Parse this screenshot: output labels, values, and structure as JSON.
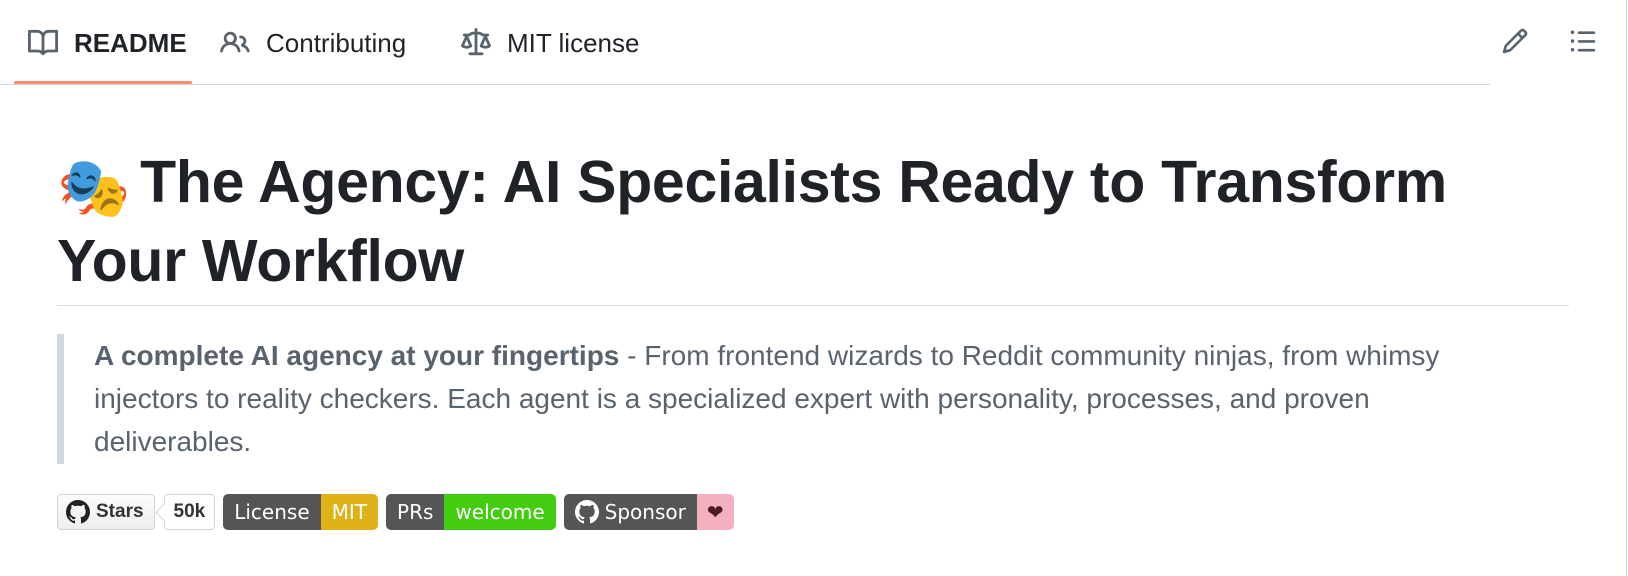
{
  "tabs": [
    {
      "label": "README",
      "icon": "book-icon",
      "active": true
    },
    {
      "label": "Contributing",
      "icon": "people-icon",
      "active": false
    },
    {
      "label": "MIT license",
      "icon": "law-scale-icon",
      "active": false
    }
  ],
  "toolbar": {
    "edit_icon": "pencil-icon",
    "toc_icon": "list-unordered-icon"
  },
  "readme": {
    "title_emoji": "🎭",
    "title": "The Agency: AI Specialists Ready to Transform Your Workflow",
    "quote_lead": "A complete AI agency at your fingertips",
    "quote_rest": " - From frontend wizards to Reddit community ninjas, from whimsy injectors to reality checkers. Each agent is a specialized expert with personality, processes, and proven deliverables."
  },
  "badges": {
    "stars": {
      "label": "Stars",
      "count": "50k"
    },
    "license": {
      "label": "License",
      "value": "MIT",
      "color": "#dfb317"
    },
    "prs": {
      "label": "PRs",
      "value": "welcome",
      "color": "#44cc11"
    },
    "sponsor": {
      "label": "Sponsor",
      "value": "❤",
      "color": "#f5b0c0"
    }
  },
  "colors": {
    "active_tab_underline": "#fd8c73",
    "text": "#1f2328",
    "muted": "#59636e"
  }
}
